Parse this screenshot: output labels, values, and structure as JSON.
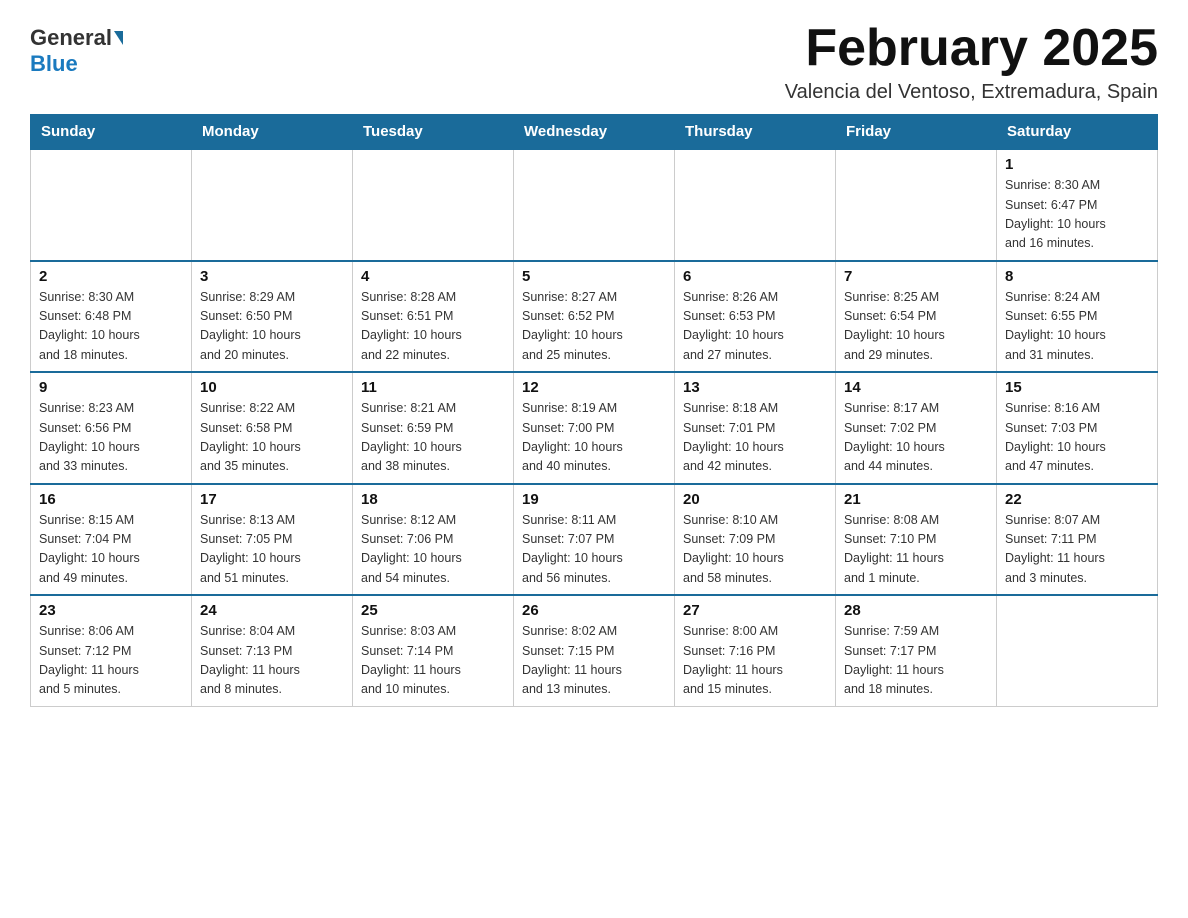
{
  "logo": {
    "general": "General",
    "blue": "Blue"
  },
  "title": "February 2025",
  "subtitle": "Valencia del Ventoso, Extremadura, Spain",
  "weekdays": [
    "Sunday",
    "Monday",
    "Tuesday",
    "Wednesday",
    "Thursday",
    "Friday",
    "Saturday"
  ],
  "weeks": [
    [
      {
        "day": "",
        "info": ""
      },
      {
        "day": "",
        "info": ""
      },
      {
        "day": "",
        "info": ""
      },
      {
        "day": "",
        "info": ""
      },
      {
        "day": "",
        "info": ""
      },
      {
        "day": "",
        "info": ""
      },
      {
        "day": "1",
        "info": "Sunrise: 8:30 AM\nSunset: 6:47 PM\nDaylight: 10 hours\nand 16 minutes."
      }
    ],
    [
      {
        "day": "2",
        "info": "Sunrise: 8:30 AM\nSunset: 6:48 PM\nDaylight: 10 hours\nand 18 minutes."
      },
      {
        "day": "3",
        "info": "Sunrise: 8:29 AM\nSunset: 6:50 PM\nDaylight: 10 hours\nand 20 minutes."
      },
      {
        "day": "4",
        "info": "Sunrise: 8:28 AM\nSunset: 6:51 PM\nDaylight: 10 hours\nand 22 minutes."
      },
      {
        "day": "5",
        "info": "Sunrise: 8:27 AM\nSunset: 6:52 PM\nDaylight: 10 hours\nand 25 minutes."
      },
      {
        "day": "6",
        "info": "Sunrise: 8:26 AM\nSunset: 6:53 PM\nDaylight: 10 hours\nand 27 minutes."
      },
      {
        "day": "7",
        "info": "Sunrise: 8:25 AM\nSunset: 6:54 PM\nDaylight: 10 hours\nand 29 minutes."
      },
      {
        "day": "8",
        "info": "Sunrise: 8:24 AM\nSunset: 6:55 PM\nDaylight: 10 hours\nand 31 minutes."
      }
    ],
    [
      {
        "day": "9",
        "info": "Sunrise: 8:23 AM\nSunset: 6:56 PM\nDaylight: 10 hours\nand 33 minutes."
      },
      {
        "day": "10",
        "info": "Sunrise: 8:22 AM\nSunset: 6:58 PM\nDaylight: 10 hours\nand 35 minutes."
      },
      {
        "day": "11",
        "info": "Sunrise: 8:21 AM\nSunset: 6:59 PM\nDaylight: 10 hours\nand 38 minutes."
      },
      {
        "day": "12",
        "info": "Sunrise: 8:19 AM\nSunset: 7:00 PM\nDaylight: 10 hours\nand 40 minutes."
      },
      {
        "day": "13",
        "info": "Sunrise: 8:18 AM\nSunset: 7:01 PM\nDaylight: 10 hours\nand 42 minutes."
      },
      {
        "day": "14",
        "info": "Sunrise: 8:17 AM\nSunset: 7:02 PM\nDaylight: 10 hours\nand 44 minutes."
      },
      {
        "day": "15",
        "info": "Sunrise: 8:16 AM\nSunset: 7:03 PM\nDaylight: 10 hours\nand 47 minutes."
      }
    ],
    [
      {
        "day": "16",
        "info": "Sunrise: 8:15 AM\nSunset: 7:04 PM\nDaylight: 10 hours\nand 49 minutes."
      },
      {
        "day": "17",
        "info": "Sunrise: 8:13 AM\nSunset: 7:05 PM\nDaylight: 10 hours\nand 51 minutes."
      },
      {
        "day": "18",
        "info": "Sunrise: 8:12 AM\nSunset: 7:06 PM\nDaylight: 10 hours\nand 54 minutes."
      },
      {
        "day": "19",
        "info": "Sunrise: 8:11 AM\nSunset: 7:07 PM\nDaylight: 10 hours\nand 56 minutes."
      },
      {
        "day": "20",
        "info": "Sunrise: 8:10 AM\nSunset: 7:09 PM\nDaylight: 10 hours\nand 58 minutes."
      },
      {
        "day": "21",
        "info": "Sunrise: 8:08 AM\nSunset: 7:10 PM\nDaylight: 11 hours\nand 1 minute."
      },
      {
        "day": "22",
        "info": "Sunrise: 8:07 AM\nSunset: 7:11 PM\nDaylight: 11 hours\nand 3 minutes."
      }
    ],
    [
      {
        "day": "23",
        "info": "Sunrise: 8:06 AM\nSunset: 7:12 PM\nDaylight: 11 hours\nand 5 minutes."
      },
      {
        "day": "24",
        "info": "Sunrise: 8:04 AM\nSunset: 7:13 PM\nDaylight: 11 hours\nand 8 minutes."
      },
      {
        "day": "25",
        "info": "Sunrise: 8:03 AM\nSunset: 7:14 PM\nDaylight: 11 hours\nand 10 minutes."
      },
      {
        "day": "26",
        "info": "Sunrise: 8:02 AM\nSunset: 7:15 PM\nDaylight: 11 hours\nand 13 minutes."
      },
      {
        "day": "27",
        "info": "Sunrise: 8:00 AM\nSunset: 7:16 PM\nDaylight: 11 hours\nand 15 minutes."
      },
      {
        "day": "28",
        "info": "Sunrise: 7:59 AM\nSunset: 7:17 PM\nDaylight: 11 hours\nand 18 minutes."
      },
      {
        "day": "",
        "info": ""
      }
    ]
  ]
}
